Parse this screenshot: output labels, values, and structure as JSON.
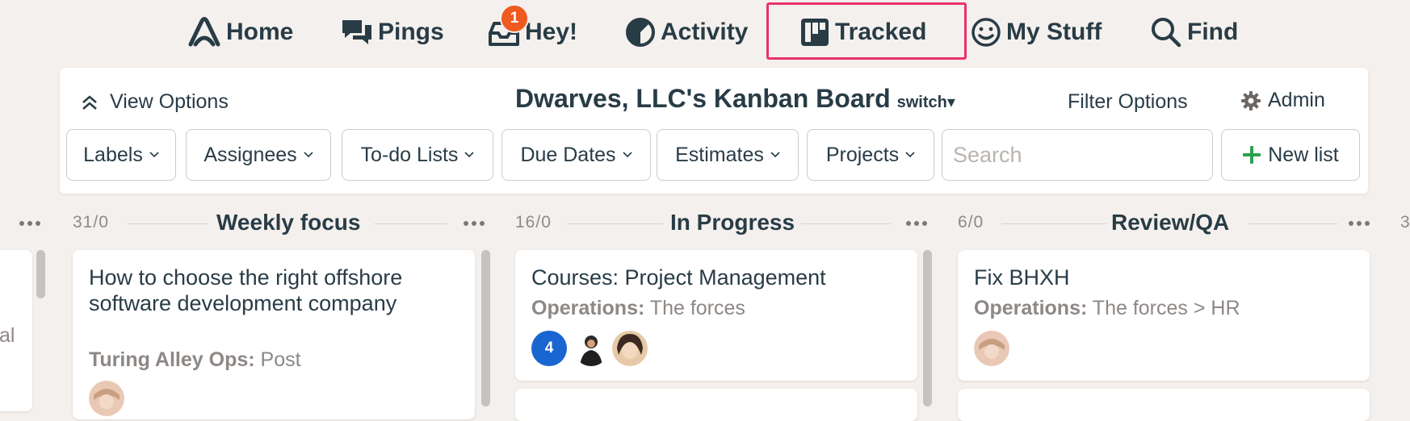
{
  "nav": {
    "home": "Home",
    "pings": "Pings",
    "hey": "Hey!",
    "hey_badge": "1",
    "activity": "Activity",
    "tracked": "Tracked",
    "my_stuff": "My Stuff",
    "find": "Find",
    "highlight_color": "#e8336b"
  },
  "panel": {
    "view_options": "View Options",
    "board_title": "Dwarves, LLC's Kanban Board",
    "switch": "switch▾",
    "filter_options": "Filter Options",
    "admin": "Admin",
    "filters": [
      "Labels",
      "Assignees",
      "To-do Lists",
      "Due Dates",
      "Estimates",
      "Projects"
    ],
    "search_placeholder": "Search",
    "new_list": "New list",
    "new_list_icon_color": "#2aa24b"
  },
  "columns": [
    {
      "count": "31/0",
      "title": "Weekly focus",
      "cards": [
        {
          "title": "How to choose the right offshore software development company",
          "project": "Turing Alley Ops:",
          "list": "Post"
        }
      ]
    },
    {
      "count": "16/0",
      "title": "In Progress",
      "cards": [
        {
          "title": "Courses: Project Management",
          "project": "Operations:",
          "list": "The forces",
          "badge": "4"
        }
      ]
    },
    {
      "count": "6/0",
      "title": "Review/QA",
      "cards": [
        {
          "title": "Fix BHXH",
          "project": "Operations:",
          "list": "The forces > HR"
        }
      ]
    }
  ],
  "left_partial": {
    "text": "al"
  },
  "right_partial": {
    "text": "3"
  }
}
